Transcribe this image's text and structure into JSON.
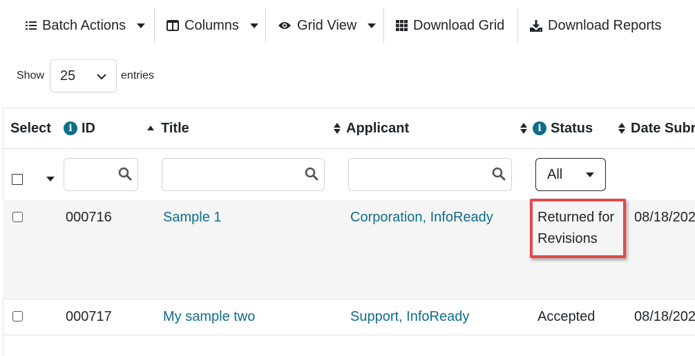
{
  "toolbar": {
    "batch_actions": "Batch Actions",
    "columns": "Columns",
    "grid_view": "Grid View",
    "download_grid": "Download Grid",
    "download_reports": "Download Reports"
  },
  "length": {
    "show_label": "Show",
    "value": "25",
    "entries_label": "entries"
  },
  "table": {
    "headers": {
      "select": "Select",
      "id": "ID",
      "title": "Title",
      "applicant": "Applicant",
      "status": "Status",
      "date": "Date Subr"
    },
    "status_filter": "All",
    "rows": [
      {
        "id": "000716",
        "title": "Sample 1",
        "applicant": "Corporation, InfoReady",
        "status_line1": "Returned for",
        "status_line2": "Revisions",
        "date": "08/18/202"
      },
      {
        "id": "000717",
        "title": "My sample two",
        "applicant": "Support, InfoReady",
        "status_line1": "Accepted",
        "status_line2": "",
        "date": "08/18/202"
      }
    ]
  },
  "colors": {
    "link": "#0d6e8c",
    "highlight": "#e8474a",
    "info": "#0d6e8c"
  },
  "icons": {
    "batch_actions": "list-icon",
    "columns": "columns-icon",
    "grid_view": "eye-icon",
    "download_grid": "grid-icon",
    "download_reports": "download-icon",
    "filter": "search-icon"
  }
}
